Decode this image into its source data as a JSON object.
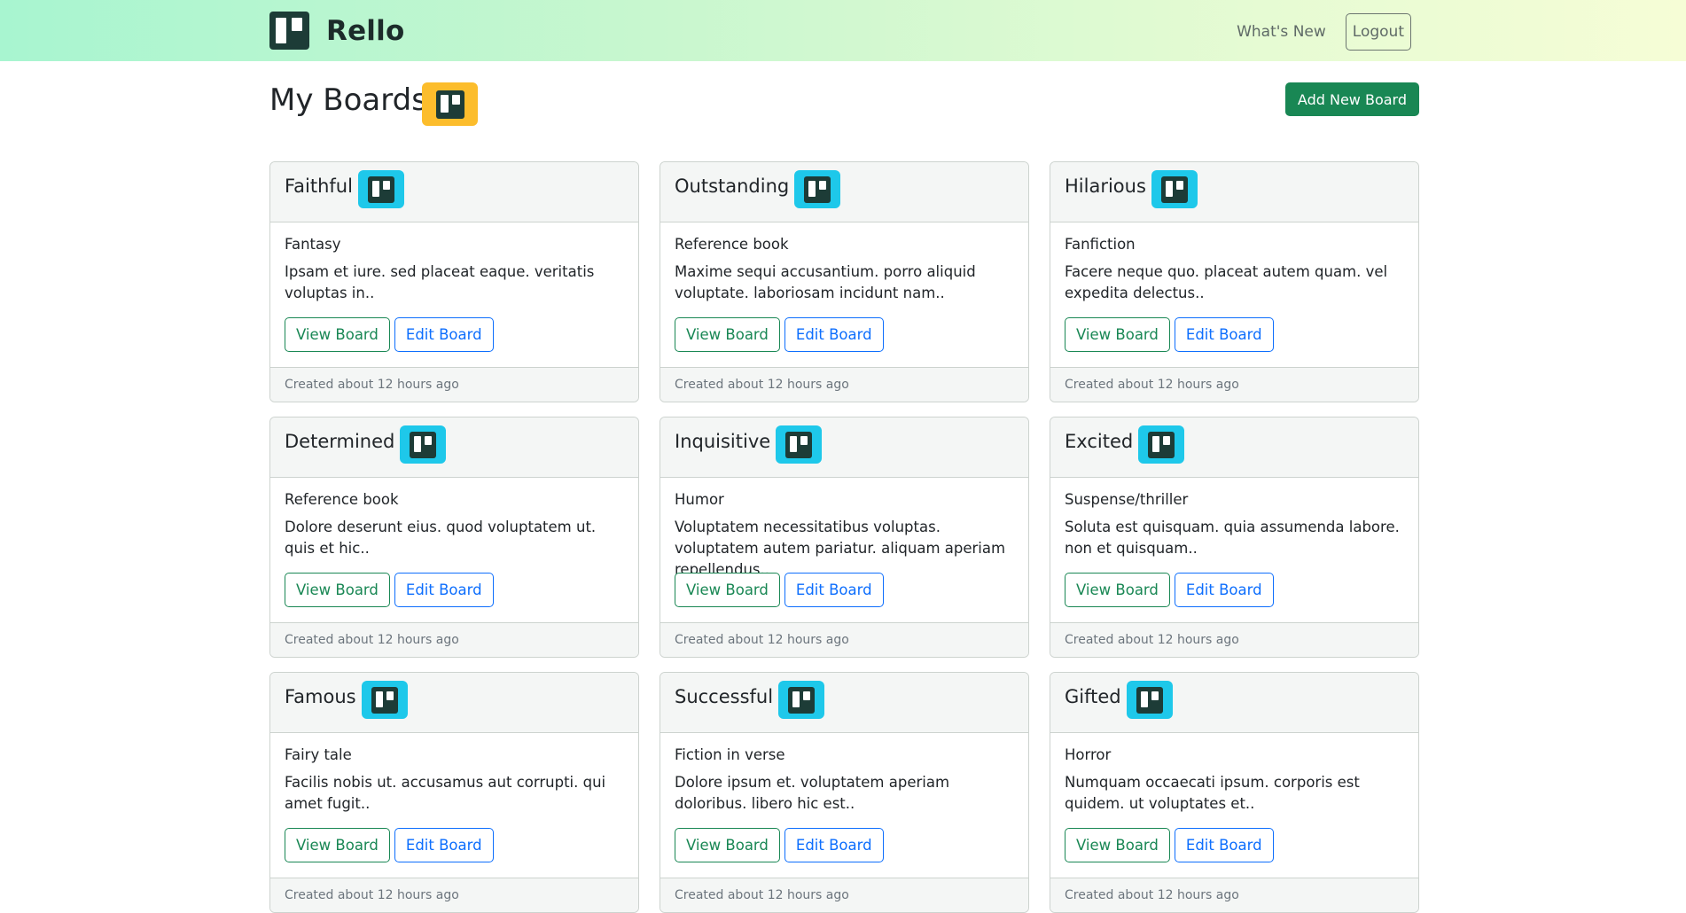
{
  "nav": {
    "brand": "Rello",
    "whats_new": "What's New",
    "logout": "Logout"
  },
  "header": {
    "title": "My Boards",
    "add_button": "Add New Board"
  },
  "colors": {
    "accent_green": "#198754",
    "accent_blue": "#0d6efd",
    "title_badge": "#fcbd2c",
    "card_badge": "#1ec8ea"
  },
  "icons": {
    "logo": "trello-board-icon"
  },
  "boards": [
    {
      "title": "Faithful",
      "genre": "Fantasy",
      "description": "Ipsam et iure. sed placeat eaque. veritatis voluptas in..",
      "view_label": "View Board",
      "edit_label": "Edit Board",
      "created": "Created about 12 hours ago"
    },
    {
      "title": "Outstanding",
      "genre": "Reference book",
      "description": "Maxime sequi accusantium. porro aliquid voluptate. laboriosam incidunt nam..",
      "view_label": "View Board",
      "edit_label": "Edit Board",
      "created": "Created about 12 hours ago"
    },
    {
      "title": "Hilarious",
      "genre": "Fanfiction",
      "description": "Facere neque quo. placeat autem quam. vel expedita delectus..",
      "view_label": "View Board",
      "edit_label": "Edit Board",
      "created": "Created about 12 hours ago"
    },
    {
      "title": "Determined",
      "genre": "Reference book",
      "description": "Dolore deserunt eius. quod voluptatem ut. quis et hic..",
      "view_label": "View Board",
      "edit_label": "Edit Board",
      "created": "Created about 12 hours ago"
    },
    {
      "title": "Inquisitive",
      "genre": "Humor",
      "description": "Voluptatem necessitatibus voluptas. voluptatem autem pariatur. aliquam aperiam repellendus..",
      "view_label": "View Board",
      "edit_label": "Edit Board",
      "created": "Created about 12 hours ago"
    },
    {
      "title": "Excited",
      "genre": "Suspense/thriller",
      "description": "Soluta est quisquam. quia assumenda labore. non et quisquam..",
      "view_label": "View Board",
      "edit_label": "Edit Board",
      "created": "Created about 12 hours ago"
    },
    {
      "title": "Famous",
      "genre": "Fairy tale",
      "description": "Facilis nobis ut. accusamus aut corrupti. qui amet fugit..",
      "view_label": "View Board",
      "edit_label": "Edit Board",
      "created": "Created about 12 hours ago"
    },
    {
      "title": "Successful",
      "genre": "Fiction in verse",
      "description": "Dolore ipsum et. voluptatem aperiam doloribus. libero hic est..",
      "view_label": "View Board",
      "edit_label": "Edit Board",
      "created": "Created about 12 hours ago"
    },
    {
      "title": "Gifted",
      "genre": "Horror",
      "description": "Numquam occaecati ipsum. corporis est quidem. ut voluptates et..",
      "view_label": "View Board",
      "edit_label": "Edit Board",
      "created": "Created about 12 hours ago"
    }
  ]
}
